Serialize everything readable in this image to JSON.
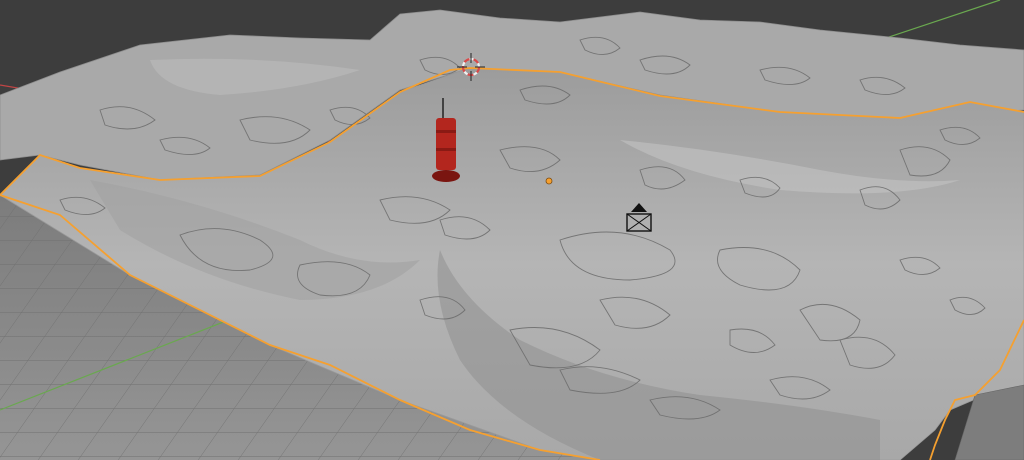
{
  "viewport": {
    "name": "3D Viewport",
    "background_color": "#3d3d3d",
    "grid_floor_color": "#8c8c8c",
    "grid_line_color": "#6f6f6f"
  },
  "axes": {
    "x_axis_color": "#c04545",
    "y_axis_color": "#6aa84f"
  },
  "terrain": {
    "object": "ocean-floor-mesh",
    "fill_color": "#b9b9b9",
    "shadow_color": "#8a8a8a",
    "contour_color": "#6b6b6b",
    "selected": true,
    "selection_outline_color": "#f5a030"
  },
  "buoy": {
    "object": "red-navigation-buoy",
    "body_color": "#b3261e",
    "base_color": "#7a1510",
    "mast_color": "#2a2a2a"
  },
  "camera": {
    "object": "camera",
    "color": "#111111"
  },
  "cursor_3d": {
    "ring_color_a": "#d94a4a",
    "ring_color_b": "#f0f0f0",
    "crosshair_color": "#222222"
  },
  "origin": {
    "color": "#f5a030"
  }
}
